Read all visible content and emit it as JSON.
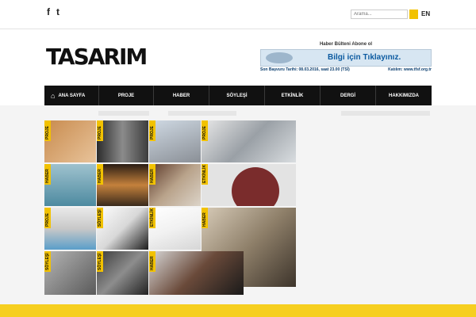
{
  "topbar": {
    "facebook_icon": "f",
    "twitter_icon": "t",
    "search_placeholder": "Arama...",
    "lang": "EN"
  },
  "header": {
    "logo": "TASARIM",
    "ad": {
      "title": "Haber Bülteni Abone ol",
      "cta": "Bilgi için Tıklayınız.",
      "deadline": "Son Başvuru Tarihi: 08.03.2016, saat 23.00 (TSİ)",
      "contact": "Katılım: www.tfsf.org.tr"
    }
  },
  "nav": {
    "items": [
      {
        "label": "ANA SAYFA"
      },
      {
        "label": "PROJE"
      },
      {
        "label": "HABER"
      },
      {
        "label": "SÖYLEŞİ"
      },
      {
        "label": "ETKİNLİK"
      },
      {
        "label": "DERGİ"
      },
      {
        "label": "HAKKIMIZDA"
      }
    ]
  },
  "tiles": [
    {
      "tag": "PROJE"
    },
    {
      "tag": "PROJE"
    },
    {
      "tag": "PROJE"
    },
    {
      "tag": "PROJE"
    },
    {
      "tag": "HABER"
    },
    {
      "tag": "HABER"
    },
    {
      "tag": "HABER"
    },
    {
      "tag": "ETKİNLİK"
    },
    {
      "tag": "PROJE"
    },
    {
      "tag": "SÖYLEŞİ"
    },
    {
      "tag": "ETKİNLİK"
    },
    {
      "tag": "HABER"
    },
    {
      "tag": "SÖYLEŞİ"
    },
    {
      "tag": "SÖYLEŞİ"
    },
    {
      "tag": "HABER"
    }
  ],
  "colors": {
    "accent": "#f2c200",
    "nav_bg": "#111111"
  }
}
